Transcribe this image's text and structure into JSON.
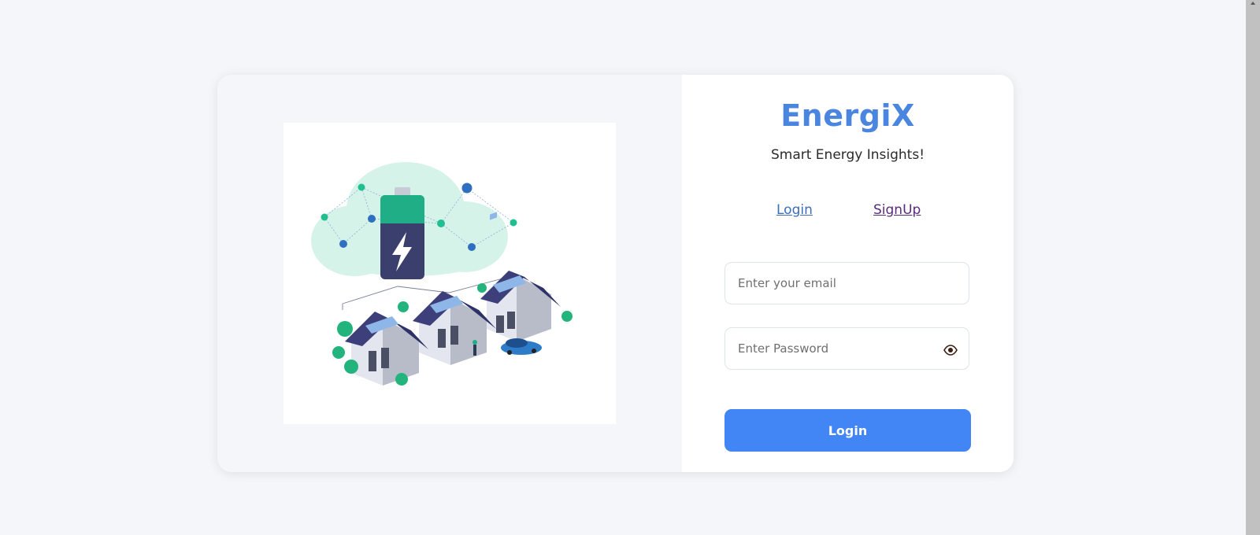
{
  "brand": {
    "name": "EnergiX",
    "tagline": "Smart Energy Insights!",
    "color": "#4a86e0"
  },
  "tabs": {
    "login_label": "Login",
    "signup_label": "SignUp"
  },
  "form": {
    "email_placeholder": "Enter your email",
    "password_placeholder": "Enter Password",
    "submit_label": "Login",
    "submit_color": "#4285f4"
  },
  "icons": {
    "password_toggle": "eye-icon"
  }
}
